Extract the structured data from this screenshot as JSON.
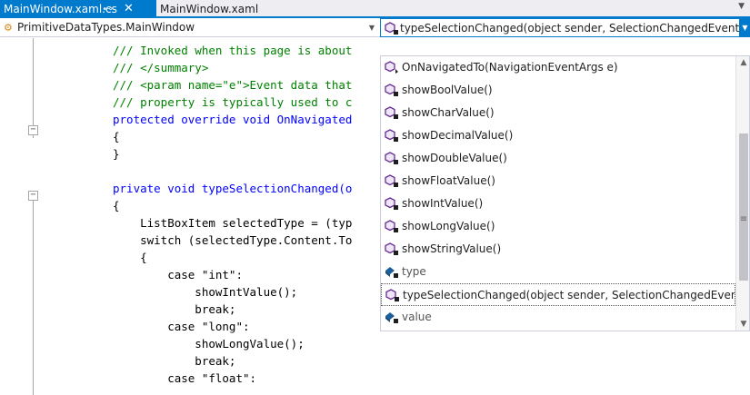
{
  "tabs": [
    {
      "label": "MainWindow.xaml.cs",
      "active": true
    },
    {
      "label": "MainWindow.xaml",
      "active": false
    }
  ],
  "tab_icons": {
    "pin": "pin-icon",
    "close": "close-icon"
  },
  "navbar": {
    "class_combo": "PrimitiveDataTypes.MainWindow",
    "member_combo": "typeSelectionChanged(object sender, SelectionChangedEventArgs e)"
  },
  "code_lines": [
    "/// Invoked when this page is about",
    "/// </summary>",
    "/// <param name=\"e\">Event data that",
    "/// property is typically used to c",
    "protected override void OnNavigated",
    "{",
    "}",
    "",
    "private void typeSelectionChanged(o",
    "{",
    "    ListBoxItem selectedType = (typ",
    "    switch (selectedType.Content.To",
    "    {",
    "        case \"int\":",
    "            showIntValue();",
    "            break;",
    "        case \"long\":",
    "            showLongValue();",
    "            break;",
    "        case \"float\":"
  ],
  "members": [
    {
      "label": "OnNavigatedTo(NavigationEventArgs e)",
      "kind": "method",
      "access": "protected"
    },
    {
      "label": "showBoolValue()",
      "kind": "method",
      "access": "private"
    },
    {
      "label": "showCharValue()",
      "kind": "method",
      "access": "private"
    },
    {
      "label": "showDecimalValue()",
      "kind": "method",
      "access": "private"
    },
    {
      "label": "showDoubleValue()",
      "kind": "method",
      "access": "private"
    },
    {
      "label": "showFloatValue()",
      "kind": "method",
      "access": "private"
    },
    {
      "label": "showIntValue()",
      "kind": "method",
      "access": "private"
    },
    {
      "label": "showLongValue()",
      "kind": "method",
      "access": "private"
    },
    {
      "label": "showStringValue()",
      "kind": "method",
      "access": "private"
    },
    {
      "label": "type",
      "kind": "field",
      "access": "private"
    },
    {
      "label": "typeSelectionChanged(object sender, SelectionChangedEventArgs e)",
      "kind": "method",
      "access": "private",
      "selected": true
    },
    {
      "label": "value",
      "kind": "field",
      "access": "private"
    }
  ],
  "colors": {
    "accent": "#007acc",
    "method_icon": "#652d90",
    "field_icon": "#1c5e9c",
    "keyword": "#0000ff",
    "string": "#a31515",
    "comment": "#008000",
    "type": "#2b91af"
  }
}
